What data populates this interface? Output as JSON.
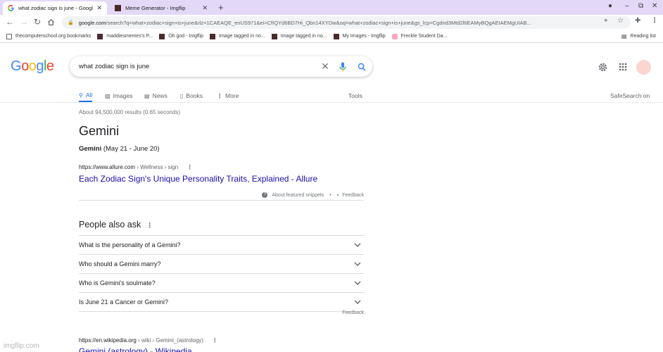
{
  "browser": {
    "tabs": [
      {
        "title": "what zodiac sign is june - Googl",
        "active": true,
        "favicon": "google-g-icon"
      },
      {
        "title": "Meme Generator - Imgflip",
        "active": false,
        "favicon": "imgflip-icon"
      }
    ],
    "url_host": "google.com",
    "url_rest": "/search?q=what+zodiac+sign+is+june&rlz=1CAEAQE_enUS971&ei=CfIQYd6BD7Hi_Qbn14XYDw&oq=what+zodiac+sign+is+june&gs_lcp=Cgdnd3Mtd2l6EAMyBQgAEIAEMgUIAB...",
    "bookmarks": [
      {
        "label": "thecomputerschool.org bookmarks",
        "icon": "folder-icon"
      },
      {
        "label": "maddiesmemes's P...",
        "icon": "imgflip-icon"
      },
      {
        "label": "Oh god - Imgflip",
        "icon": "imgflip-icon"
      },
      {
        "label": "Image tagged in no...",
        "icon": "imgflip-icon"
      },
      {
        "label": "Image tagged in no...",
        "icon": "imgflip-icon"
      },
      {
        "label": "My Images - Imgflip",
        "icon": "imgflip-icon"
      },
      {
        "label": "Freckle Student Da...",
        "icon": "freckle-icon"
      }
    ],
    "reading_list": "Reading list"
  },
  "google": {
    "logo_letters": [
      {
        "ch": "G",
        "color": "#4285f4"
      },
      {
        "ch": "o",
        "color": "#ea4335"
      },
      {
        "ch": "o",
        "color": "#fbbc05"
      },
      {
        "ch": "g",
        "color": "#4285f4"
      },
      {
        "ch": "l",
        "color": "#34a853"
      },
      {
        "ch": "e",
        "color": "#ea4335"
      }
    ],
    "query": "what zodiac sign is june",
    "tabs": [
      {
        "label": "All",
        "icon": "search-icon",
        "active": true
      },
      {
        "label": "Images",
        "icon": "image-icon"
      },
      {
        "label": "News",
        "icon": "news-icon"
      },
      {
        "label": "Books",
        "icon": "book-icon"
      },
      {
        "label": "More",
        "icon": "kebab-icon"
      }
    ],
    "tools": "Tools",
    "safesearch": "SafeSearch on"
  },
  "results": {
    "stats": "About 94,500,000 results (0.65 seconds)",
    "featured": {
      "title": "Gemini",
      "bold": "Gemini",
      "rest": " (May 21 - June 20)",
      "cite_host": "https://www.allure.com",
      "cite_path": " › Wellness › sign",
      "link": "Each Zodiac Sign's Unique Personality Traits, Explained - Allure",
      "about": "About featured snippets",
      "feedback": "Feedback"
    },
    "paa": {
      "title": "People also ask",
      "questions": [
        "What is the personality of a Gemini?",
        "Who should a Gemini marry?",
        "Who is Gemini's soulmate?",
        "Is June 21 a Cancer or Gemini?"
      ],
      "feedback": "Feedback"
    },
    "next": {
      "cite_host": "https://en.wikipedia.org",
      "cite_path": " › wiki › Gemini_(astrology)",
      "link": "Gemini (astrology) - Wikipedia"
    }
  },
  "watermark": "imgflip.com",
  "colors": {
    "link": "#1a0dab",
    "accent": "#1a73e8",
    "tabstrip": "#e3d8f6"
  }
}
